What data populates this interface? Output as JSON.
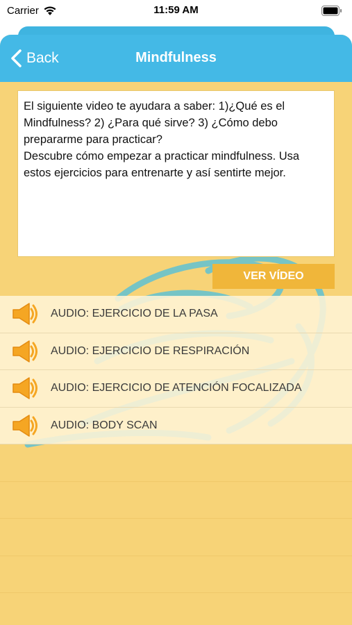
{
  "status_bar": {
    "carrier": "Carrier",
    "time": "11:59 AM"
  },
  "nav": {
    "back_label": "Back",
    "title": "Mindfulness"
  },
  "intro": {
    "text": "El siguiente video te ayudara a saber: 1)¿Qué es el Mindfulness? 2) ¿Para qué sirve? 3) ¿Cómo debo prepararme para practicar?\nDescubre cómo empezar a practicar mindfulness.  Usa estos ejercicios para entrenarte y así sentirte mejor."
  },
  "video_button": {
    "label": "VER VÍDEO"
  },
  "audios": [
    {
      "label": "AUDIO: EJERCICIO DE LA PASA"
    },
    {
      "label": "AUDIO: EJERCICIO DE RESPIRACIÓN"
    },
    {
      "label": "AUDIO: EJERCICIO DE ATENCIÓN FOCALIZADA"
    },
    {
      "label": "AUDIO: BODY SCAN"
    }
  ],
  "colors": {
    "nav_blue": "#44b9e6",
    "background_yellow": "#f7d377",
    "button_orange": "#f0b63a",
    "speaker_orange": "#f5a623",
    "scribble_blue": "#4cbfe0"
  }
}
